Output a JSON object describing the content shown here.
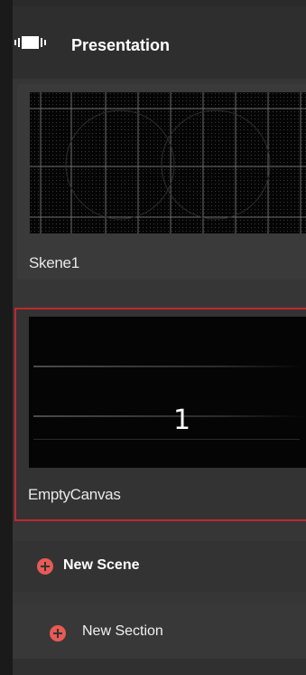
{
  "header": {
    "title": "Presentation",
    "icon": "presentation-icon"
  },
  "scenes": [
    {
      "label": "Skene1",
      "thumbnail": "grid-pattern",
      "selected": false
    },
    {
      "label": "EmptyCanvas",
      "thumbnail": "empty-canvas",
      "number": "1",
      "selected": true
    }
  ],
  "actions": {
    "new_scene": "New Scene",
    "new_section": "New Section"
  },
  "colors": {
    "selection_border": "#c2272d",
    "plus_icon": "#e85a55",
    "panel_bg": "#363636"
  }
}
